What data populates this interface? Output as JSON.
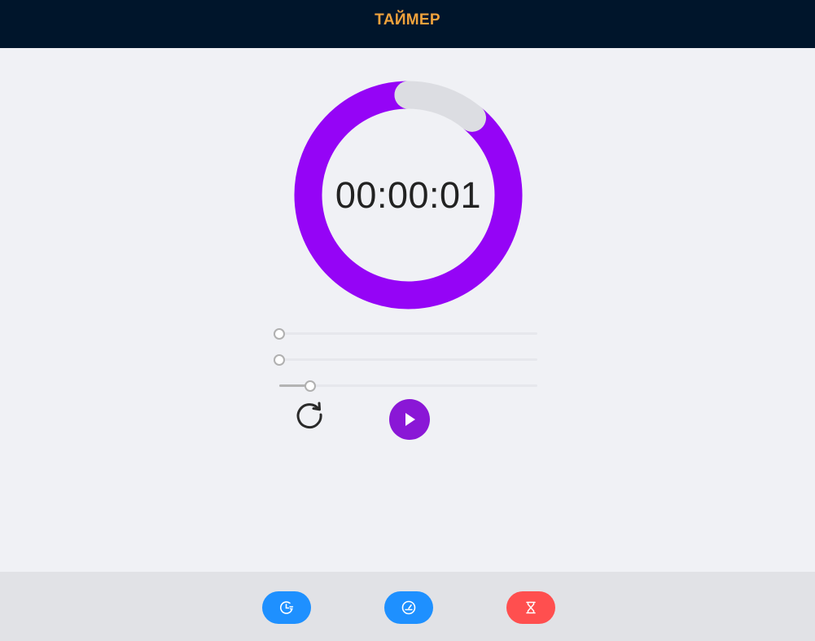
{
  "header": {
    "title": "ТАЙМЕР"
  },
  "timer": {
    "display": "00:00:01",
    "progress_fraction": 0.89,
    "ring_color": "#9504f6",
    "ring_track_color": "#dcdde2"
  },
  "sliders": [
    {
      "name": "hours",
      "value_fraction": 0.0
    },
    {
      "name": "minutes",
      "value_fraction": 0.0
    },
    {
      "name": "seconds",
      "value_fraction": 0.12
    }
  ],
  "controls": {
    "reset_icon": "refresh-icon",
    "play_icon": "play-icon",
    "play_color": "#8a17d6"
  },
  "nav": [
    {
      "icon": "clock-icon",
      "color": "#1e90ff",
      "active": false
    },
    {
      "icon": "speedometer-icon",
      "color": "#1e90ff",
      "active": false
    },
    {
      "icon": "hourglass-icon",
      "color": "#ff4f4f",
      "active": true
    }
  ],
  "colors": {
    "header_bg": "#00152b",
    "header_text": "#f0a23c",
    "page_bg": "#f0f1f5",
    "footer_bg": "#e1e2e6"
  }
}
